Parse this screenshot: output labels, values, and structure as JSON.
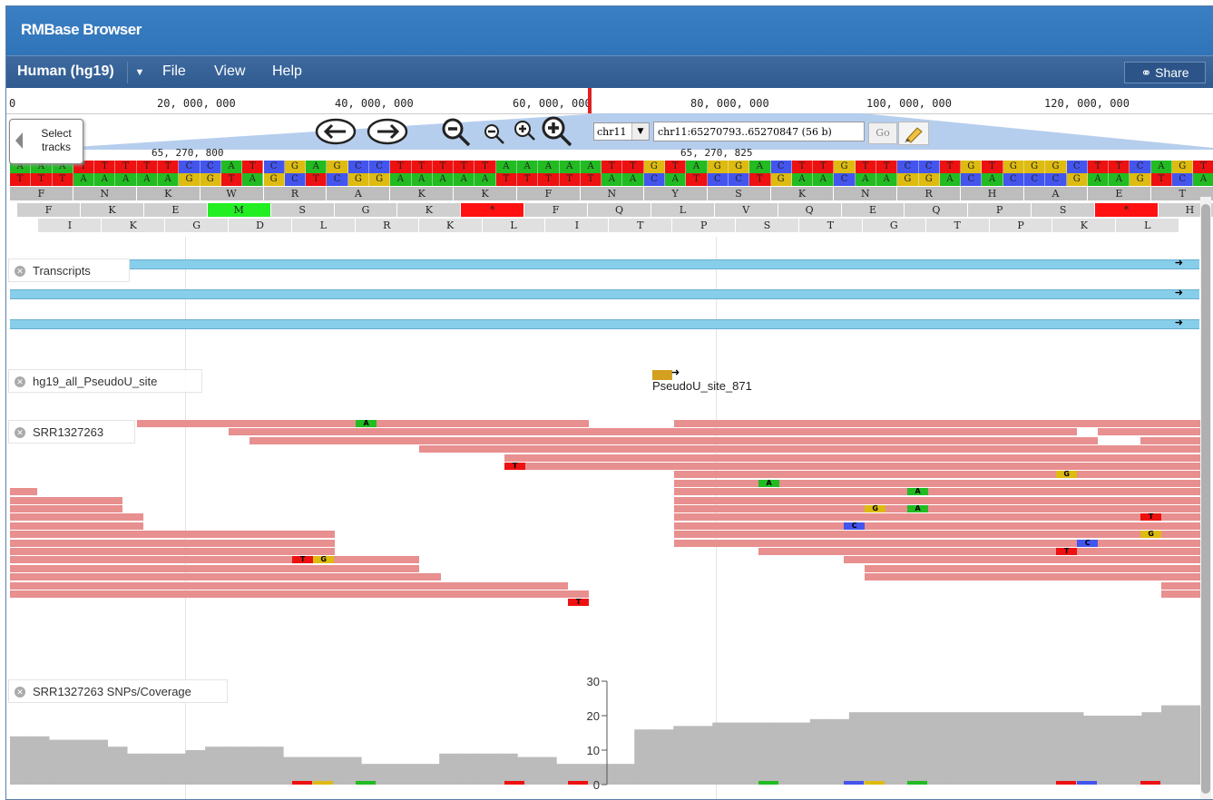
{
  "app": {
    "title": "RMBase Browser"
  },
  "menubar": {
    "genome": "Human (hg19)",
    "items": [
      "File",
      "View",
      "Help"
    ],
    "share": "Share"
  },
  "overview": {
    "ticks": [
      "0",
      "20, 000, 000",
      "40, 000, 000",
      "60, 000, 000",
      "80, 000, 000",
      "100, 000, 000",
      "120, 000, 000"
    ]
  },
  "nav": {
    "chrom": "chr11",
    "location": "chr11:65270793..65270847 (56 b)",
    "go": "Go",
    "select_tracks": "Select tracks"
  },
  "scale": {
    "left": "65, 270, 800",
    "right": "65, 270, 825"
  },
  "sequence": {
    "forward": "AAATTTTTCCATCGAGCCTTTTTAAAAATTGTAGGACTTGTTCCTGTGGGCTTCAGT",
    "reverse": "TTTAAAAAGGTAGCTCGGAAAAATTTTTAACATCCTGAACAAGGACACCCGAAGTCA",
    "frame1": [
      "F",
      "N",
      "K",
      "W",
      "R",
      "A",
      "K",
      "K",
      "F",
      "N",
      "Y",
      "S",
      "K",
      "N",
      "R",
      "H",
      "A",
      "E",
      "T"
    ],
    "frame2": [
      "F",
      "K",
      "E",
      "M",
      "S",
      "G",
      "K",
      "*",
      "F",
      "Q",
      "L",
      "V",
      "Q",
      "E",
      "Q",
      "P",
      "S",
      "*",
      "H"
    ],
    "frame3": [
      "I",
      "K",
      "G",
      "D",
      "L",
      "R",
      "K",
      "L",
      "I",
      "T",
      "P",
      "S",
      "T",
      "G",
      "T",
      "P",
      "K",
      "L"
    ]
  },
  "colors": {
    "A": "#22bb22",
    "T": "#ee1111",
    "G": "#ddbb11",
    "C": "#4455ee",
    "read": "#e88f8f",
    "transcript": "#87ceeb",
    "coverage": "#bbbbbb",
    "header": "#3b7fc4",
    "menubar": "#3e6aa0"
  },
  "tracks": {
    "transcripts": "Transcripts",
    "pseudou": "hg19_all_PseudoU_site",
    "pseudou_feature": "PseudoU_site_871",
    "reads": "SRR1327263",
    "coverage": "SRR1327263 SNPs/Coverage",
    "coverage_axis": [
      "0",
      "10",
      "20",
      "30"
    ]
  },
  "chart_data": {
    "type": "area",
    "series": [
      {
        "name": "SRR1327263",
        "values": [
          14,
          14,
          13,
          13,
          13,
          11,
          9,
          9,
          9,
          10,
          11,
          11,
          11,
          11,
          8,
          8,
          8,
          8,
          6,
          6,
          6,
          6,
          9,
          9,
          9,
          9,
          8,
          8,
          6,
          6,
          6,
          6,
          16,
          16,
          17,
          17,
          18,
          18,
          18,
          18,
          18,
          19,
          19,
          21,
          21,
          21,
          21,
          21,
          21,
          21,
          21,
          21,
          21,
          21,
          21,
          20,
          20,
          20,
          21,
          23,
          23
        ]
      }
    ],
    "ylim": [
      0,
      30
    ],
    "yticks": [
      0,
      10,
      20,
      30
    ]
  }
}
